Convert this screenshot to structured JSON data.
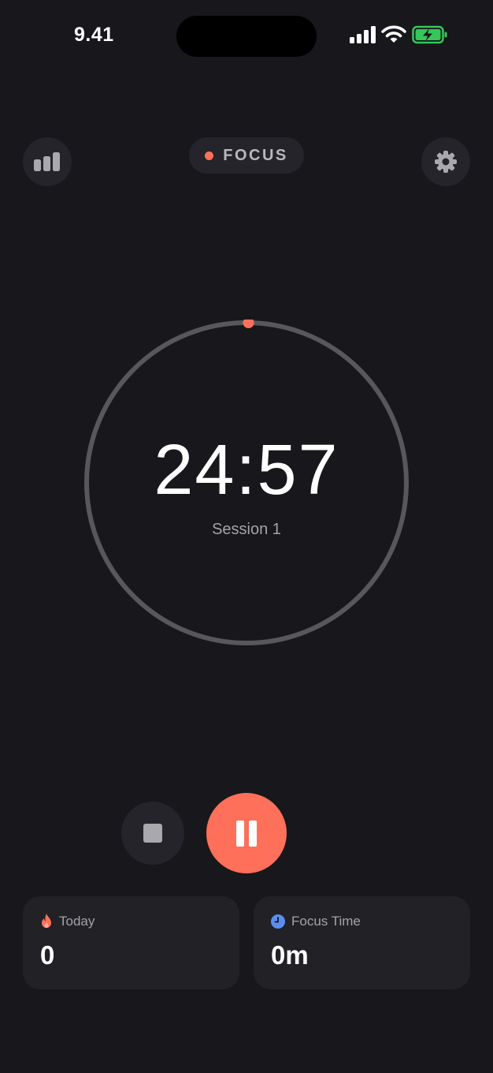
{
  "status_bar": {
    "time": "9.41"
  },
  "header": {
    "mode_label": "FOCUS",
    "mode_color": "#ff705a",
    "left_icon": "bar-chart-icon",
    "right_icon": "gear-icon"
  },
  "timer": {
    "time": "24:57",
    "session_label": "Session 1",
    "progress": 0.002
  },
  "controls": {
    "stop_icon": "stop-icon",
    "pause_icon": "pause-icon",
    "accent_color": "#ff705a"
  },
  "stats": [
    {
      "label": "Today",
      "value": "0",
      "icon": "flame-icon",
      "icon_color": "#ff705a"
    },
    {
      "label": "Focus Time",
      "value": "0m",
      "icon": "clock-icon",
      "icon_color": "#5b8def"
    }
  ]
}
